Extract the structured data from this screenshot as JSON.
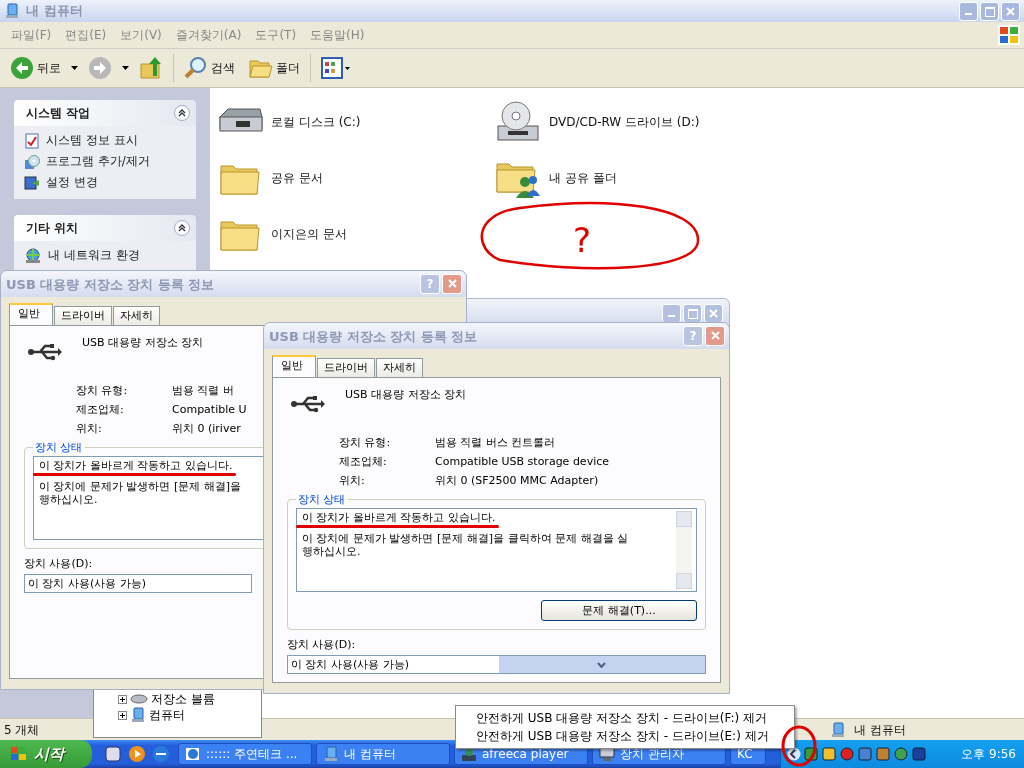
{
  "explorer": {
    "title": "내 컴퓨터",
    "menu": [
      "파일(F)",
      "편집(E)",
      "보기(V)",
      "즐겨찾기(A)",
      "도구(T)",
      "도움말(H)"
    ],
    "toolbar": [
      {
        "kind": "back",
        "label": "뒤로"
      },
      {
        "kind": "forward"
      },
      {
        "kind": "up"
      },
      {
        "kind": "search",
        "label": "검색"
      },
      {
        "kind": "folders",
        "label": "폴더"
      },
      {
        "kind": "views"
      }
    ],
    "sidebar": [
      {
        "title": "시스템 작업",
        "expanded": true,
        "items": [
          {
            "kind": "info",
            "label": "시스템 정보 표시"
          },
          {
            "kind": "programs",
            "label": "프로그램 추가/제거"
          },
          {
            "kind": "settings",
            "label": "설정 변경"
          }
        ]
      },
      {
        "title": "기타 위치",
        "expanded": true,
        "items": [
          {
            "kind": "network",
            "label": "내 네트워크 환경"
          }
        ]
      }
    ],
    "items": [
      {
        "kind": "disk",
        "label": "로컬 디스크 (C:)"
      },
      {
        "kind": "dvd",
        "label": "DVD/CD-RW 드라이브 (D:)"
      },
      {
        "kind": "folder",
        "label": "공유 문서"
      },
      {
        "kind": "shared-folder",
        "label": "내 공유 폴더"
      },
      {
        "kind": "folder",
        "label": "이지은의 문서"
      }
    ],
    "status_bar": [
      "5 개체",
      "내 컴퓨터"
    ]
  },
  "annotation": {
    "label": "?"
  },
  "device_tree": [
    {
      "kind": "volume",
      "label": "저장소 볼륨",
      "expanded": false
    },
    {
      "kind": "computer",
      "label": "컴퓨터",
      "expanded": false
    }
  ],
  "dialogs": [
    {
      "title": "USB 대용량 저장소 장치 등록 정보",
      "help_button": "?",
      "tabs": [
        {
          "label": "일반",
          "selected": true
        },
        {
          "label": "드라이버",
          "selected": false
        },
        {
          "label": "자세히",
          "selected": false
        }
      ],
      "device_name": "USB 대용량 저장소 장치",
      "properties": [
        {
          "label": "장치 유형:",
          "value": "범용 직렬 버"
        },
        {
          "label": "제조업체:",
          "value": "Compatible U"
        },
        {
          "label": "위치:",
          "value": "위치 0 (iriver"
        }
      ],
      "status_title": "장치 상태",
      "status_message": {
        "text": "이 장치가 올바르게 작동하고 있습니다.",
        "underlined": true
      },
      "status_detail": [
        "이 장치에 문제가 발생하면 [문제 해결]을",
        "행하십시오."
      ],
      "usage_label": "장치 사용(D):",
      "usage_value": "이 장치 사용(사용 가능)"
    },
    {
      "title": "USB 대용량 저장소 장치 등록 정보",
      "help_button": "?",
      "tabs": [
        {
          "label": "일반",
          "selected": true
        },
        {
          "label": "드라이버",
          "selected": false
        },
        {
          "label": "자세히",
          "selected": false
        }
      ],
      "device_name": "USB 대용량 저장소 장치",
      "properties": [
        {
          "label": "장치 유형:",
          "value": "범용 직렬 버스 컨트롤러"
        },
        {
          "label": "제조업체:",
          "value": "Compatible USB storage device"
        },
        {
          "label": "위치:",
          "value": "위치 0 (SF2500 MMC Adapter)"
        }
      ],
      "status_title": "장치 상태",
      "status_message": {
        "text": "이 장치가 올바르게 작동하고 있습니다.",
        "underlined": true
      },
      "status_detail": [
        "이 장치에 문제가 발생하면 [문제 해결]을 클릭하여 문제 해결을 실",
        "행하십시오."
      ],
      "troubleshoot_button": "문제 해결(T)...",
      "usage_label": "장치 사용(D):",
      "usage_value": "이 장치 사용(사용 가능)"
    }
  ],
  "balloon": {
    "items": [
      "안전하게 USB 대용량 저장소 장치 - 드라이브(F:) 제거",
      "안전하게 USB 대용량 저장소 장치 - 드라이브(E:) 제거"
    ]
  },
  "taskbar": {
    "start": "시작",
    "tasks": [
      {
        "kind": "browser",
        "label": ":::::: 주연테크 ..."
      },
      {
        "kind": "computer",
        "label": "내 컴퓨터"
      },
      {
        "kind": "player",
        "label": "afreeca player"
      },
      {
        "kind": "devices",
        "label": "장치 관리자"
      },
      {
        "kind": "plain",
        "label": "KC"
      }
    ],
    "clock": "오후 9:56"
  }
}
